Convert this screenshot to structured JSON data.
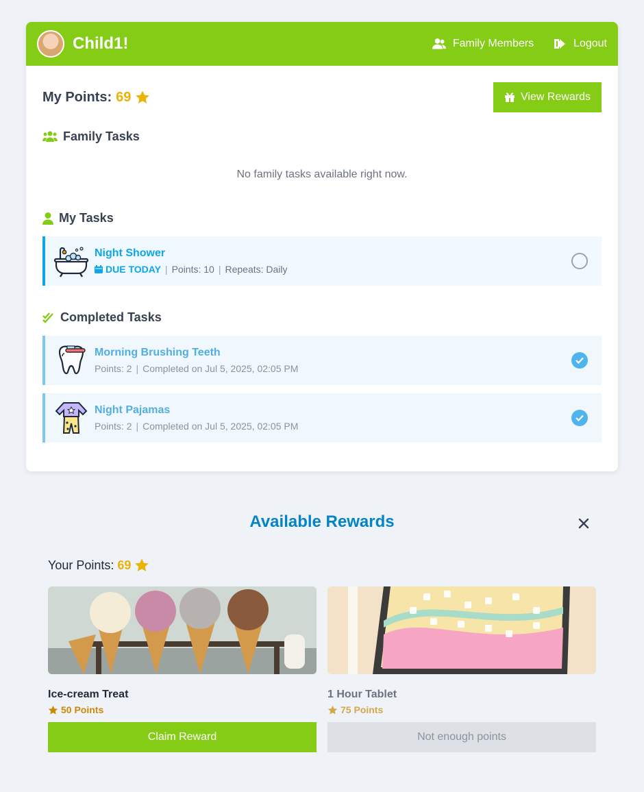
{
  "header": {
    "app_title": "Child1!",
    "nav": {
      "family_members": "Family Members",
      "logout": "Logout"
    },
    "brand_color": "#84cc16"
  },
  "points": {
    "label": "My Points:",
    "value": "69"
  },
  "view_rewards_label": "View Rewards",
  "family_tasks": {
    "title": "Family Tasks",
    "empty": "No family tasks available right now."
  },
  "my_tasks": {
    "title": "My Tasks",
    "items": [
      {
        "name": "Night Shower",
        "due": "DUE TODAY",
        "points": "Points: 10",
        "repeats": "Repeats: Daily",
        "icon": "bathtub-icon"
      }
    ]
  },
  "completed_tasks": {
    "title": "Completed Tasks",
    "items": [
      {
        "name": "Morning Brushing Teeth",
        "points": "Points: 2",
        "completed": "Completed on Jul 5, 2025, 02:05 PM",
        "icon": "tooth-icon"
      },
      {
        "name": "Night Pajamas",
        "points": "Points: 2",
        "completed": "Completed on Jul 5, 2025, 02:05 PM",
        "icon": "pajamas-icon"
      }
    ]
  },
  "rewards": {
    "title": "Available Rewards",
    "your_points_label": "Your Points:",
    "your_points_value": "69",
    "items": [
      {
        "name": "Ice-cream Treat",
        "cost": "50 Points",
        "button": "Claim Reward",
        "image": "ice-cream-photo"
      },
      {
        "name": "1 Hour Tablet",
        "cost": "75 Points",
        "button": "Not enough points",
        "image": "tablet-photo"
      }
    ]
  }
}
